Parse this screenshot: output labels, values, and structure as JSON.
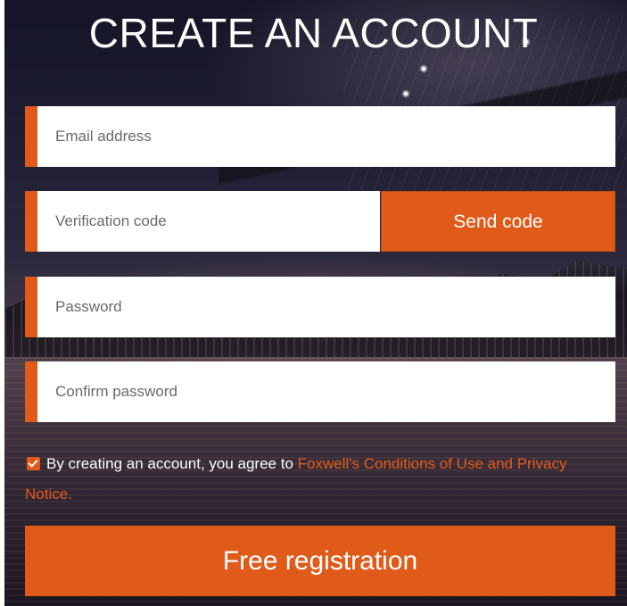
{
  "form": {
    "title": "CREATE AN ACCOUNT",
    "email_placeholder": "Email address",
    "code_placeholder": "Verification code",
    "send_code_label": "Send code",
    "password_placeholder": "Password",
    "confirm_password_placeholder": "Confirm password",
    "agree": {
      "checked": true,
      "text": "By creating an account, you agree to ",
      "link_text": "Foxwell's Conditions of Use and Privacy Notice."
    },
    "submit_label": "Free registration"
  },
  "colors": {
    "accent": "#e05a1a",
    "link": "#e55b1c",
    "field_bg": "#ffffff",
    "text_on_dark": "#ffffff"
  }
}
